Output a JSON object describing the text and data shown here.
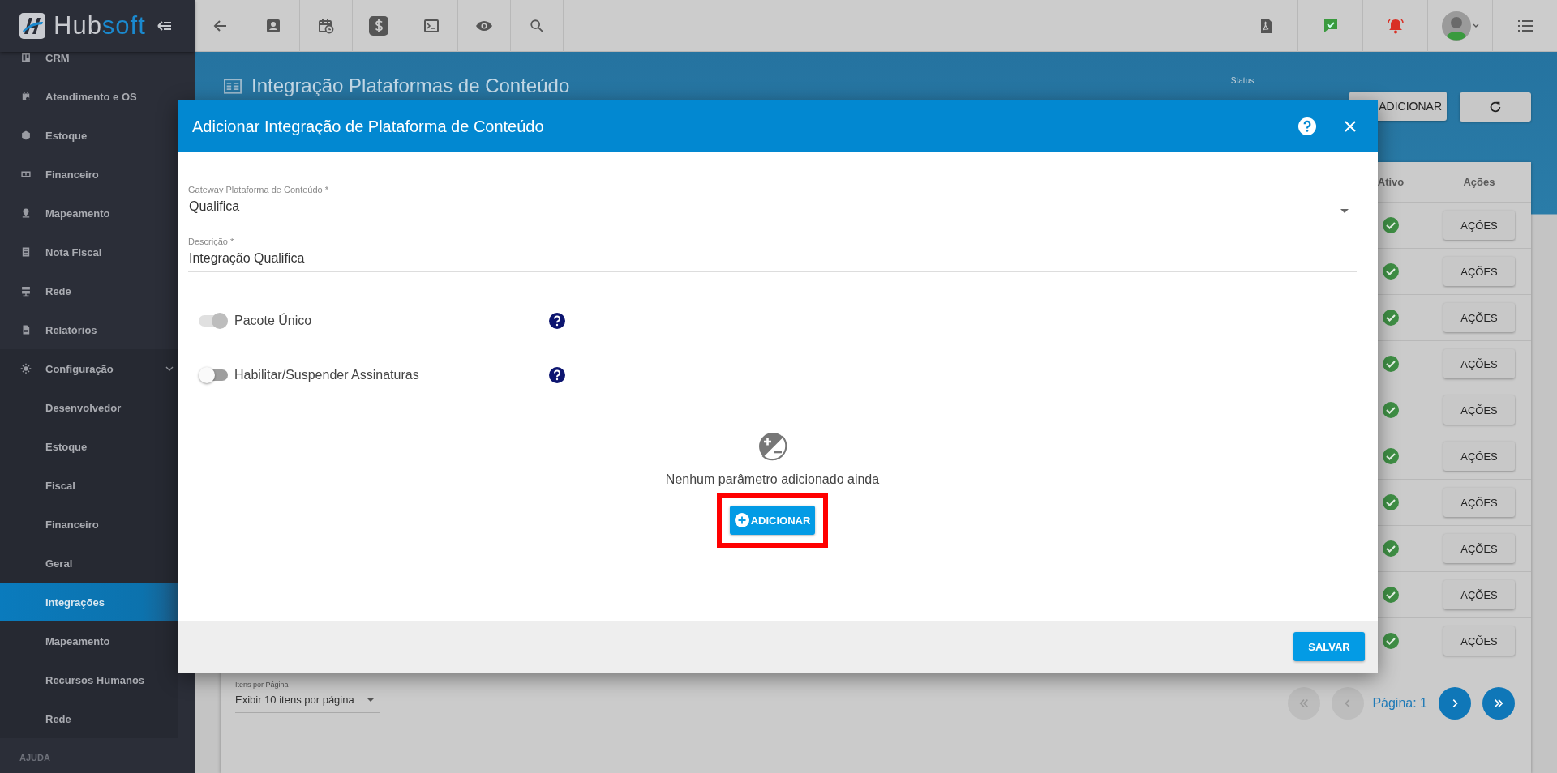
{
  "app": {
    "logo": "Hubsoft"
  },
  "sidebar": {
    "items": [
      {
        "label": "CRM",
        "selected": false
      },
      {
        "label": "Atendimento e OS",
        "selected": false
      },
      {
        "label": "Estoque",
        "selected": false
      },
      {
        "label": "Financeiro",
        "selected": false
      },
      {
        "label": "Mapeamento",
        "selected": false
      },
      {
        "label": "Nota Fiscal",
        "selected": false
      },
      {
        "label": "Rede",
        "selected": false
      },
      {
        "label": "Relatórios",
        "selected": false
      },
      {
        "label": "Configuração",
        "selected": false,
        "expanded": true,
        "children": [
          {
            "label": "Desenvolvedor",
            "selected": false
          },
          {
            "label": "Estoque",
            "selected": false
          },
          {
            "label": "Fiscal",
            "selected": false
          },
          {
            "label": "Financeiro",
            "selected": false
          },
          {
            "label": "Geral",
            "selected": false
          },
          {
            "label": "Integrações",
            "selected": true
          },
          {
            "label": "Mapeamento",
            "selected": false
          },
          {
            "label": "Recursos Humanos",
            "selected": false
          },
          {
            "label": "Rede",
            "selected": false
          }
        ]
      }
    ],
    "section": "AJUDA"
  },
  "page": {
    "title": "Integração Plataformas de Conteúdo",
    "status_label": "Status",
    "add_button": "ADICIONAR"
  },
  "table": {
    "columns": [
      "Ativo",
      "Ações"
    ],
    "rows": [
      {
        "active": true,
        "action": "AÇÕES"
      },
      {
        "active": true,
        "action": "AÇÕES"
      },
      {
        "active": true,
        "action": "AÇÕES"
      },
      {
        "active": true,
        "action": "AÇÕES"
      },
      {
        "active": true,
        "action": "AÇÕES"
      },
      {
        "active": true,
        "action": "AÇÕES"
      },
      {
        "active": true,
        "action": "AÇÕES"
      },
      {
        "active": true,
        "action": "AÇÕES"
      },
      {
        "active": true,
        "action": "AÇÕES"
      },
      {
        "active": true,
        "action": "AÇÕES"
      }
    ]
  },
  "pagination": {
    "per_page_label": "Itens por Página",
    "per_page_value": "Exibir 10 itens por página",
    "page_label": "Página: 1",
    "buttons": [
      {
        "kind": "first",
        "disabled": true
      },
      {
        "kind": "prev",
        "disabled": true
      },
      {
        "kind": "next",
        "disabled": false
      },
      {
        "kind": "last",
        "disabled": false
      }
    ]
  },
  "modal": {
    "title": "Adicionar Integração de Plataforma de Conteúdo",
    "fields": [
      {
        "kind": "select",
        "label": "Gateway Plataforma de Conteúdo *",
        "value": "Qualifica"
      },
      {
        "kind": "text",
        "label": "Descrição *",
        "value": "Integração Qualifica"
      }
    ],
    "toggles": [
      {
        "label": "Pacote Único",
        "on": true,
        "disabled": true
      },
      {
        "label": "Habilitar/Suspender Assinaturas",
        "on": false,
        "disabled": false
      }
    ],
    "empty_message": "Nenhum parâmetro adicionado ainda",
    "add_button": "ADICIONAR",
    "highlighted": true,
    "save_button": "SALVAR"
  }
}
